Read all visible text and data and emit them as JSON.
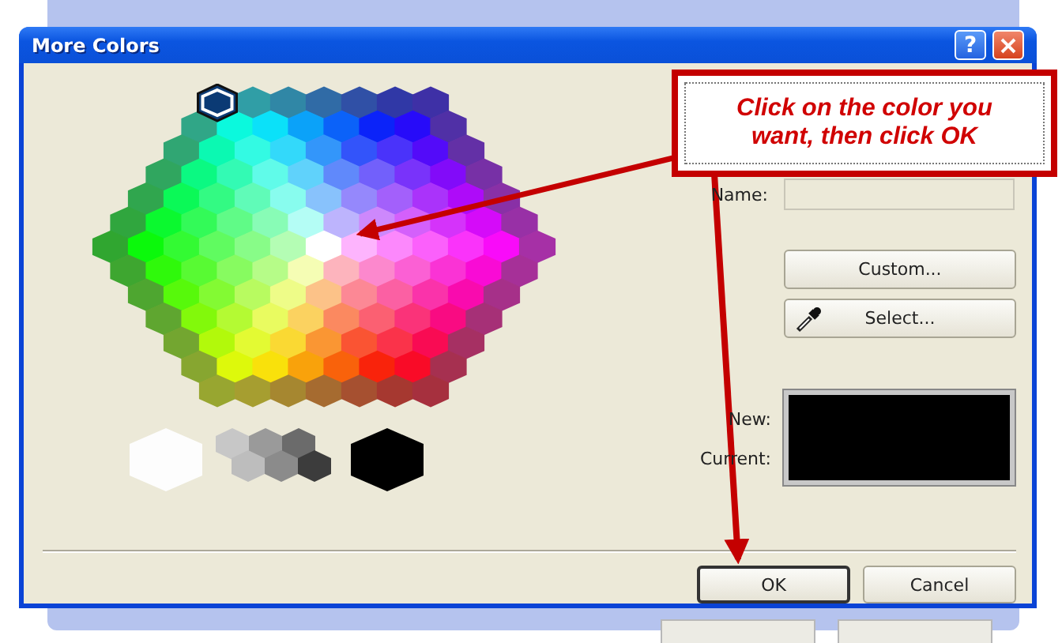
{
  "dialog": {
    "title": "More Colors",
    "help_label": "?"
  },
  "name_label": "Name:",
  "side_buttons": [
    {
      "label": "Custom...",
      "kind": "plain"
    },
    {
      "label": "Select...",
      "kind": "eyedropper"
    }
  ],
  "new_label": "New:",
  "current_label": "Current:",
  "footer_buttons": [
    {
      "label": "OK",
      "default": true
    },
    {
      "label": "Cancel",
      "default": false
    }
  ],
  "callout": {
    "text": "Click on the color you want, then click OK"
  }
}
